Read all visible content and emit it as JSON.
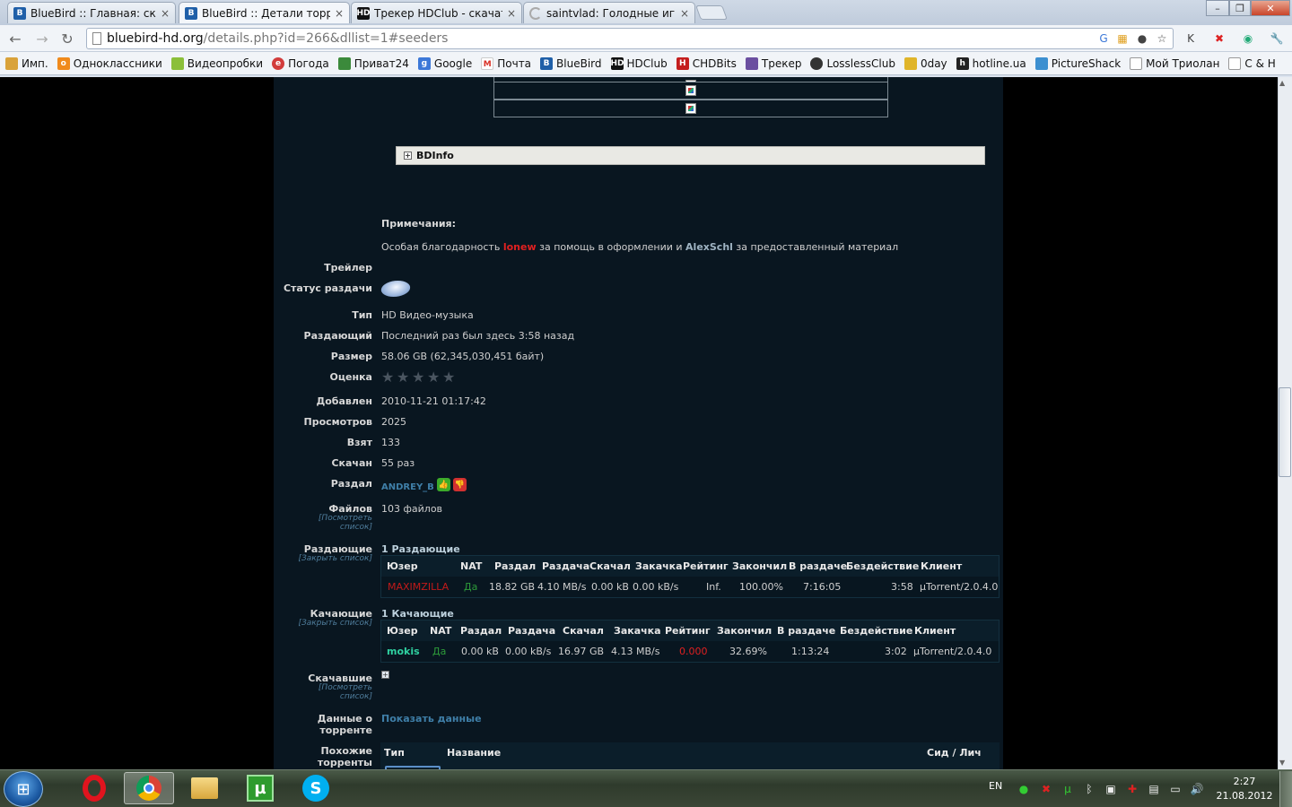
{
  "browser": {
    "tabs": [
      {
        "title": "BlueBird :: Главная: скачат",
        "favicon": "bluebird-favicon",
        "color": "#1f5fa8"
      },
      {
        "title": "BlueBird :: Детали торрент",
        "favicon": "bluebird-favicon",
        "color": "#1f5fa8"
      },
      {
        "title": "Трекер HDClub - скачать",
        "favicon": "hdclub-favicon",
        "color": "#111111"
      },
      {
        "title": "saintvlad: Голодные игры",
        "favicon": "loading-spinner-icon",
        "color": "#999999"
      }
    ],
    "url_host": "bluebird-hd.org",
    "url_rest": "/details.php?id=266&dllist=1#seeders",
    "bookmarks": [
      {
        "label": "Имп.",
        "icon": "folder-icon",
        "color": "#d9a23a"
      },
      {
        "label": "Одноклассники",
        "icon": "odnoklassniki-icon",
        "color": "#f08a1c"
      },
      {
        "label": "Видеопробки",
        "icon": "videoprobki-icon",
        "color": "#8bbf3a"
      },
      {
        "label": "Погода",
        "icon": "weather-icon",
        "color": "#d23c3c"
      },
      {
        "label": "Приват24",
        "icon": "privat24-icon",
        "color": "#3b8a3b"
      },
      {
        "label": "Google",
        "icon": "google-icon",
        "color": "#3c78d8"
      },
      {
        "label": "Почта",
        "icon": "gmail-icon",
        "color": "#d93025"
      },
      {
        "label": "BlueBird",
        "icon": "bluebird-icon",
        "color": "#1f5fa8"
      },
      {
        "label": "HDClub",
        "icon": "hdclub-icon",
        "color": "#111111"
      },
      {
        "label": "CHDBits",
        "icon": "chdbits-icon",
        "color": "#c41e1e"
      },
      {
        "label": "Трекер",
        "icon": "tracker-icon",
        "color": "#6b4fa0"
      },
      {
        "label": "LosslessClub",
        "icon": "losslessclub-icon",
        "color": "#333333"
      },
      {
        "label": "0day",
        "icon": "0day-icon",
        "color": "#e0b52a"
      },
      {
        "label": "hotline.ua",
        "icon": "hotline-icon",
        "color": "#222222"
      },
      {
        "label": "PictureShack",
        "icon": "pictureshack-icon",
        "color": "#3c8fd0"
      },
      {
        "label": "Мой Триолан",
        "icon": "page-icon",
        "color": "#ffffff"
      },
      {
        "label": "C & H",
        "icon": "page-icon",
        "color": "#ffffff"
      }
    ]
  },
  "page": {
    "bdinfo_label": "BDInfo",
    "notes_heading": "Примечания:",
    "notes_text_1": "Особая благодарность ",
    "notes_user_1": "lonew",
    "notes_text_2": " за помощь в оформлении и ",
    "notes_user_2": "AlexSchl",
    "notes_text_3": " за предоставленный материал",
    "trailer_label": "Трейлер",
    "status_label": "Статус раздачи",
    "type_label": "Тип",
    "type_value": "HD Видео-музыка",
    "seeder_label": "Раздающий",
    "seeder_value": "Последний раз был здесь 3:58 назад",
    "size_label": "Размер",
    "size_value": "58.06 GB (62,345,030,451 байт)",
    "rating_label": "Оценка",
    "rating_stars": 5,
    "added_label": "Добавлен",
    "added_value": "2010-11-21 01:17:42",
    "views_label": "Просмотров",
    "views_value": "2025",
    "taken_label": "Взят",
    "taken_value": "133",
    "downloaded_label": "Скачан",
    "downloaded_value": "55 раз",
    "uploader_label": "Раздал",
    "uploader_value": "ANDREY_B",
    "files_label": "Файлов",
    "files_sub": "[Посмотреть список]",
    "files_value": "103 файлов",
    "seeders_label": "Раздающие",
    "seeders_sub": "[Закрыть список]",
    "seeders_count": "1 Раздающие",
    "leechers_label": "Качающие",
    "leechers_sub": "[Закрыть список]",
    "leechers_count": "1 Качающие",
    "snatched_label": "Скачавшие",
    "snatched_sub": "[Посмотреть список]",
    "torrent_data_label": "Данные о торренте",
    "torrent_data_link": "Показать данные",
    "similar_label": "Похожие торренты",
    "similar_headers": [
      "Тип",
      "Название",
      "Сид / Лич"
    ]
  },
  "seeders_table": {
    "headers": [
      "Юзер",
      "NAT",
      "Раздал",
      "Раздача",
      "Скачал",
      "Закачка",
      "Рейтинг",
      "Закончил",
      "В раздаче",
      "Бездействие",
      "Клиент"
    ],
    "rows": [
      [
        "MAXIMZILLA",
        "Да",
        "18.82 GB",
        "4.10 MB/s",
        "0.00 kB",
        "0.00 kB/s",
        "Inf.",
        "100.00%",
        "7:16:05",
        "3:58",
        "µTorrent/2.0.4.0"
      ]
    ]
  },
  "leechers_table": {
    "headers": [
      "Юзер",
      "NAT",
      "Раздал",
      "Раздача",
      "Скачал",
      "Закачка",
      "Рейтинг",
      "Закончил",
      "В раздаче",
      "Бездействие",
      "Клиент"
    ],
    "rows": [
      [
        "mokis",
        "Да",
        "0.00 kB",
        "0.00 kB/s",
        "16.97 GB",
        "4.13 MB/s",
        "0.000",
        "32.69%",
        "1:13:24",
        "3:02",
        "µTorrent/2.0.4.0"
      ]
    ]
  },
  "taskbar": {
    "lang": "EN",
    "time": "2:27",
    "date": "21.08.2012"
  },
  "colors": {
    "page_bg": "#091620",
    "red_user": "#e02020",
    "link_blue": "#3f7fa8",
    "green_nat": "#2d9b3a",
    "leech_user": "#2fd0a0"
  }
}
